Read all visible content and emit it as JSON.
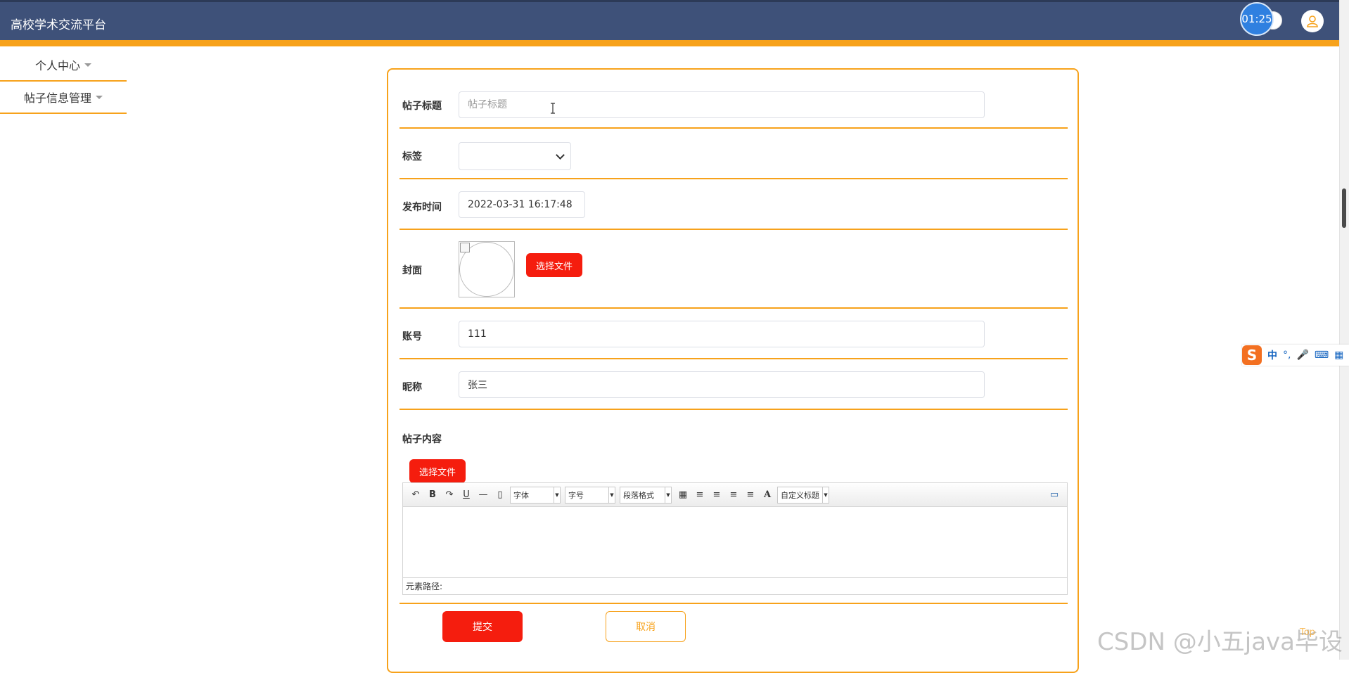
{
  "app": {
    "title": "高校学术交流平台"
  },
  "header": {
    "timer": "01:25"
  },
  "sidebar": {
    "items": [
      {
        "label": "个人中心"
      },
      {
        "label": "帖子信息管理"
      }
    ]
  },
  "form": {
    "title": {
      "label": "帖子标题",
      "placeholder": "帖子标题",
      "value": ""
    },
    "tag": {
      "label": "标签",
      "selected": ""
    },
    "publish_time": {
      "label": "发布时间",
      "value": "2022-03-31 16:17:48"
    },
    "cover": {
      "label": "封面",
      "button": "选择文件"
    },
    "account": {
      "label": "账号",
      "value": "111"
    },
    "nickname": {
      "label": "昵称",
      "value": "张三"
    },
    "content": {
      "label": "帖子内容",
      "button": "选择文件",
      "toolbar": {
        "font_family": "字体",
        "font_size": "字号",
        "paragraph": "段落格式",
        "custom_title": "自定义标题"
      },
      "status": "元素路径:"
    },
    "submit": "提交",
    "cancel": "取消"
  },
  "ime": {
    "label": "中"
  },
  "watermark": "CSDN @小五java毕设",
  "ghost": "Top"
}
